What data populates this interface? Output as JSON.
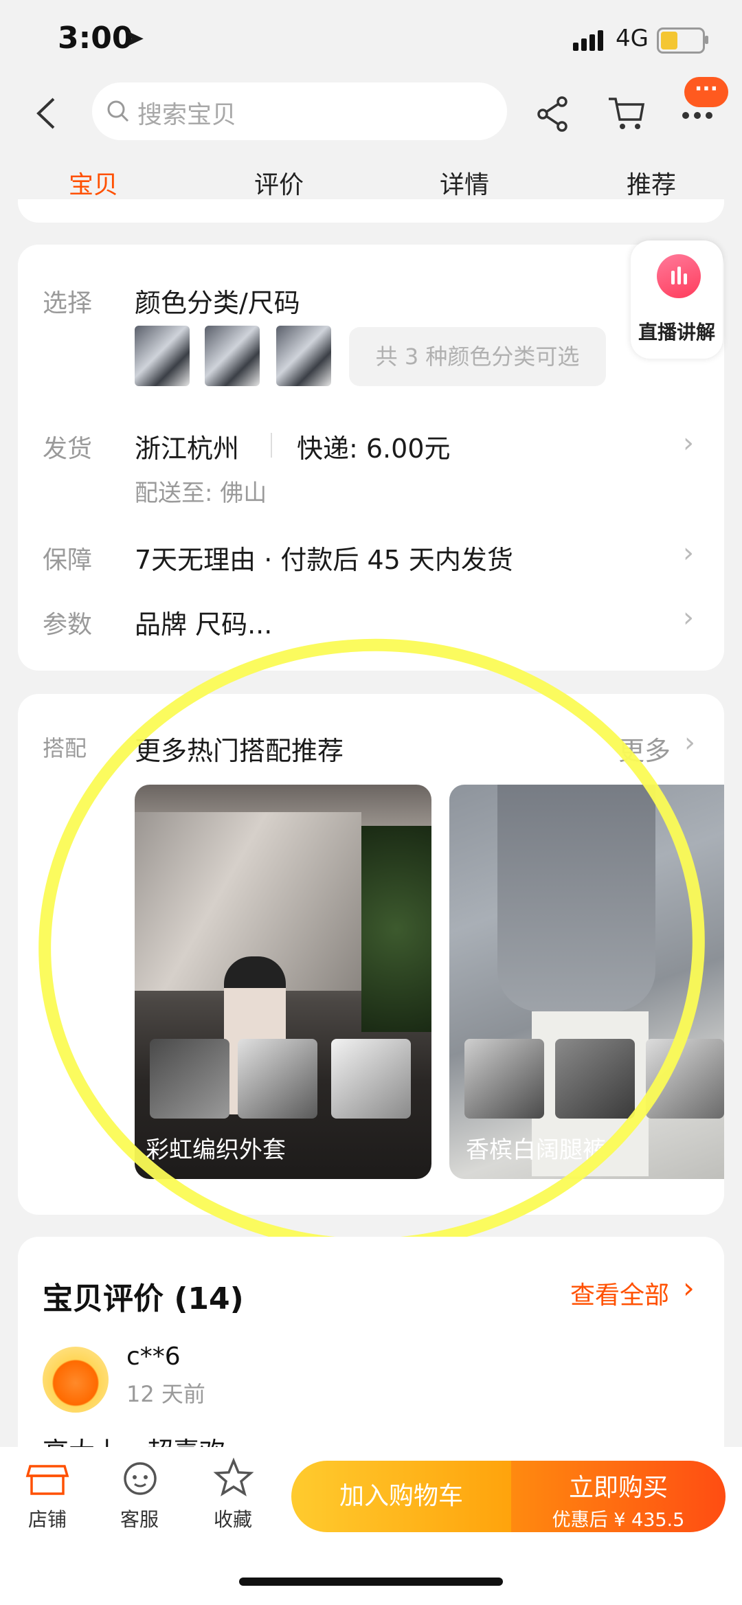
{
  "status_bar": {
    "time": "3:00",
    "network": "4G"
  },
  "search": {
    "placeholder": "搜索宝贝"
  },
  "more_badge": "···",
  "tabs": [
    {
      "label": "宝贝",
      "active": true
    },
    {
      "label": "评价",
      "active": false
    },
    {
      "label": "详情",
      "active": false
    },
    {
      "label": "推荐",
      "active": false
    }
  ],
  "live": {
    "label": "直播讲解"
  },
  "specs": {
    "select": {
      "label": "选择",
      "value": "颜色分类/尺码",
      "chip": "共 3 种颜色分类可选"
    },
    "shipping": {
      "label": "发货",
      "origin": "浙江杭州",
      "fee": "快递: 6.00元",
      "deliver_to": "配送至: 佛山"
    },
    "guarantee": {
      "label": "保障",
      "value": "7天无理由 · 付款后 45 天内发货"
    },
    "params": {
      "label": "参数",
      "value": "品牌 尺码..."
    }
  },
  "outfit": {
    "label": "搭配",
    "title": "更多热门搭配推荐",
    "more": "更多",
    "items": [
      {
        "caption": "彩虹编织外套"
      },
      {
        "caption": "香槟白阔腿裤"
      }
    ]
  },
  "reviews": {
    "title": "宝贝评价 (14)",
    "view_all": "查看全部",
    "first": {
      "user": "c**6",
      "time": "12 天前",
      "text": "高大上，超喜欢"
    }
  },
  "bottom": {
    "shop": "店铺",
    "service": "客服",
    "favorite": "收藏",
    "add_cart": "加入购物车",
    "buy_now": "立即购买",
    "buy_price": "优惠后 ¥ 435.5"
  },
  "colors": {
    "accent": "#ff5000",
    "highlight": "#fbfb55"
  }
}
